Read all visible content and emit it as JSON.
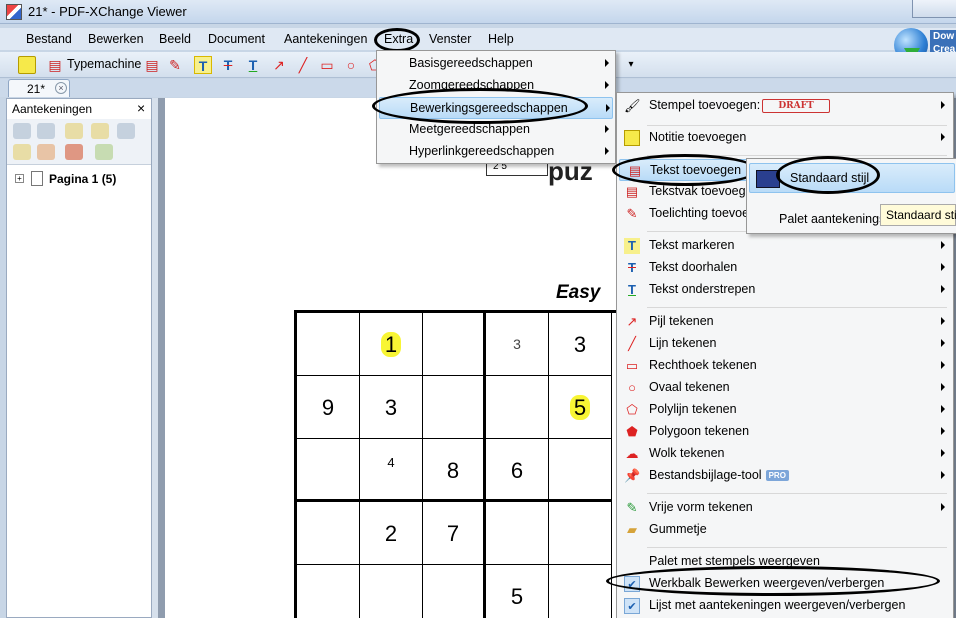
{
  "window": {
    "title": "21* - PDF-XChange Viewer"
  },
  "menubar": [
    "Bestand",
    "Bewerken",
    "Beeld",
    "Document",
    "Aantekeningen",
    "Extra",
    "Venster",
    "Help"
  ],
  "download": {
    "line1": "Dow",
    "line2": "Crea"
  },
  "toolbar": {
    "typewriter_label": "Typemachine"
  },
  "tab": {
    "label": "21*"
  },
  "panel": {
    "title": "Aantekeningen",
    "close": "×",
    "tree_label": "Pagina 1 (5)"
  },
  "page": {
    "easy": "Easy",
    "puzzle_title": "puz",
    "mini": "2   5"
  },
  "sudoku": {
    "cells": [
      [
        "",
        "1",
        "",
        "3",
        "3",
        ""
      ],
      [
        "9",
        "3",
        "",
        "",
        "5",
        ""
      ],
      [
        "",
        "4",
        "8",
        "6",
        "",
        ""
      ],
      [
        "",
        "2",
        "7",
        "",
        "",
        ""
      ],
      [
        "",
        "",
        "",
        "5",
        "",
        ""
      ]
    ]
  },
  "extra_menu": {
    "items": [
      "Basisgereedschappen",
      "Zoomgereedschappen",
      "Bewerkingsgereedschappen",
      "Meetgereedschappen",
      "Hyperlinkgereedschappen"
    ]
  },
  "edit_menu": {
    "stamp": "Stempel toevoegen:",
    "stamp_badge": "DRAFT",
    "note": "Notitie toevoegen",
    "text": "Tekst toevoegen",
    "textbox": "Tekstvak toevoegen",
    "callout": "Toelichting toevoegen",
    "highlight": "Tekst markeren",
    "strike": "Tekst doorhalen",
    "underline": "Tekst onderstrepen",
    "arrow": "Pijl tekenen",
    "line": "Lijn tekenen",
    "rect": "Rechthoek tekenen",
    "oval": "Ovaal tekenen",
    "polyline": "Polylijn tekenen",
    "polygon": "Polygoon tekenen",
    "cloud": "Wolk tekenen",
    "attach": "Bestandsbijlage-tool",
    "pro_badge": "PRO",
    "freehand": "Vrije vorm tekenen",
    "eraser": "Gummetje",
    "stamp_palette": "Palet met stempels weergeven",
    "toggle_toolbar": "Werkbalk Bewerken weergeven/verbergen",
    "toggle_list": "Lijst met aantekeningen weergeven/verbergen"
  },
  "sub_menu": {
    "standard": "Standaard stijl",
    "palette": "Palet aantekeningss"
  },
  "tooltip": {
    "text": "Standaard stij"
  }
}
